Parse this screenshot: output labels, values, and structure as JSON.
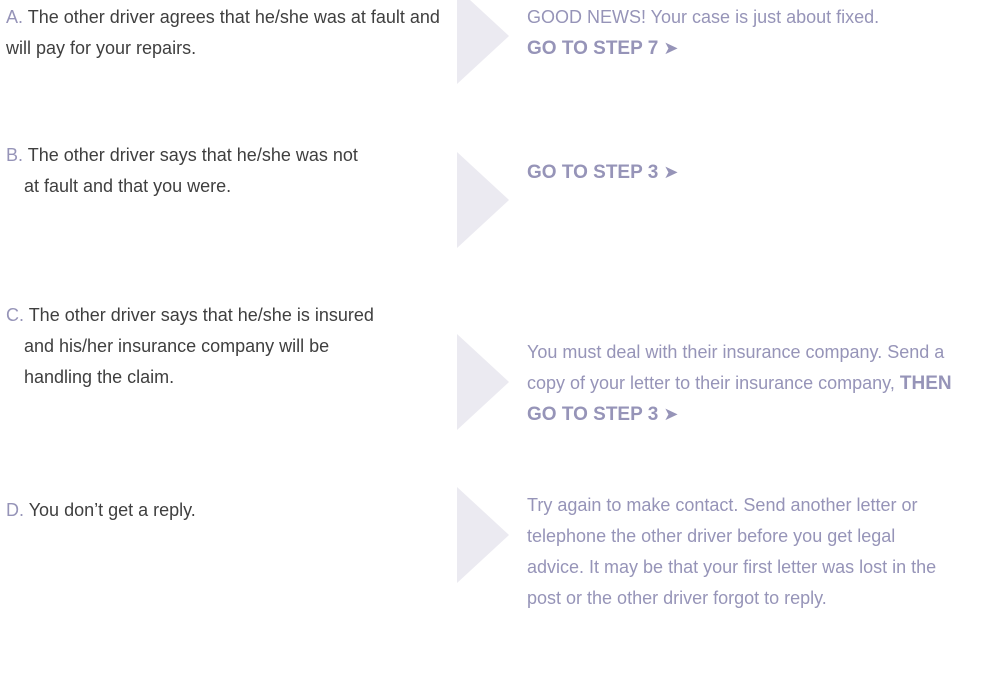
{
  "colors": {
    "accent": "#9694b8",
    "text": "#3f3f3f",
    "arrow": "#ebeaf1"
  },
  "rows": [
    {
      "letter": "A.",
      "condition": "The other driver agrees that he/she was at fault and will pay for your repairs.",
      "result_text": "GOOD NEWS! Your case is just about fixed.",
      "result_bold": "GO TO STEP 7",
      "arrow_glyph": "➤"
    },
    {
      "letter": "B.",
      "condition": "The other driver says that he/she was not at fault and that you were.",
      "result_text": "",
      "result_bold": "GO TO STEP 3",
      "arrow_glyph": "➤"
    },
    {
      "letter": "C.",
      "condition": "The other driver says that he/she is insured and his/her insurance company will be handling the claim.",
      "result_text": "You must deal with their insurance company. Send a copy of your letter to their insurance company,",
      "result_bold": "THEN GO TO STEP 3",
      "arrow_glyph": "➤"
    },
    {
      "letter": "D.",
      "condition": "You don’t get a reply.",
      "result_text": "Try again to make contact. Send another letter or telephone the other driver before you get legal advice. It may be that your first letter was lost in the post or the other driver forgot to reply.",
      "result_bold": "",
      "arrow_glyph": ""
    }
  ]
}
